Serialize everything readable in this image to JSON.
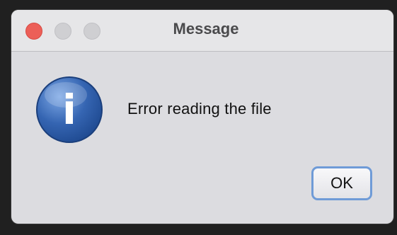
{
  "window": {
    "title": "Message"
  },
  "window_controls": {
    "close": "close-icon",
    "minimize": "minimize-icon",
    "maximize": "maximize-icon"
  },
  "dialog": {
    "icon": "information-icon",
    "icon_glyph": "i",
    "message": "Error reading the file",
    "ok_label": "OK"
  },
  "colors": {
    "close_button": "#ec5f58",
    "inactive_button": "#cfcfd2",
    "dialog_background": "#dcdce0",
    "icon_blue": "#2f5ea8",
    "button_focus_ring": "#6f9bd7"
  }
}
